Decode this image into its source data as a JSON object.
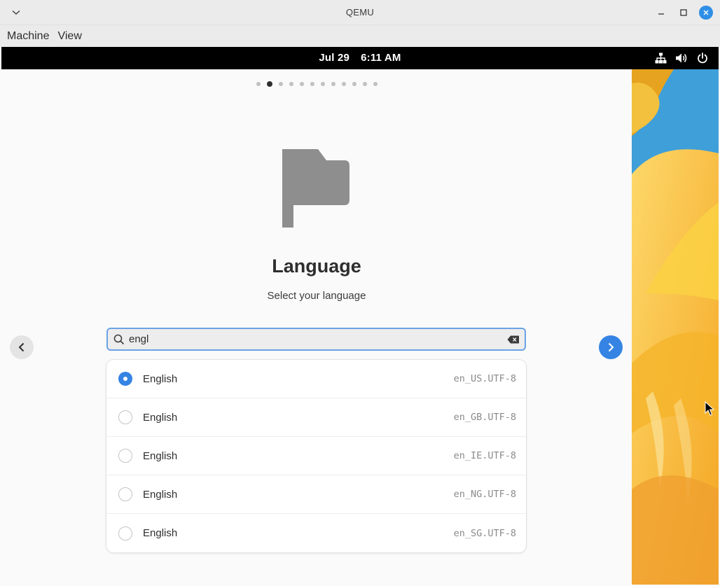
{
  "window": {
    "title": "QEMU",
    "menu": [
      "Machine",
      "View"
    ]
  },
  "topbar": {
    "date": "Jul 29",
    "time": "6:11 AM",
    "icons": [
      "network-icon",
      "volume-icon",
      "power-icon"
    ]
  },
  "setup": {
    "pages_total": 12,
    "current_page": 2,
    "heading": "Language",
    "subheading": "Select your language",
    "search": {
      "value": "engl",
      "icon": "search-icon"
    },
    "languages": [
      {
        "name": "English",
        "locale": "en_US.UTF-8",
        "selected": true
      },
      {
        "name": "English",
        "locale": "en_GB.UTF-8",
        "selected": false
      },
      {
        "name": "English",
        "locale": "en_IE.UTF-8",
        "selected": false
      },
      {
        "name": "English",
        "locale": "en_NG.UTF-8",
        "selected": false
      },
      {
        "name": "English",
        "locale": "en_SG.UTF-8",
        "selected": false
      }
    ]
  },
  "colors": {
    "accent": "#3584e4",
    "topbar": "#000000",
    "close_button": "#2f8fe6"
  }
}
